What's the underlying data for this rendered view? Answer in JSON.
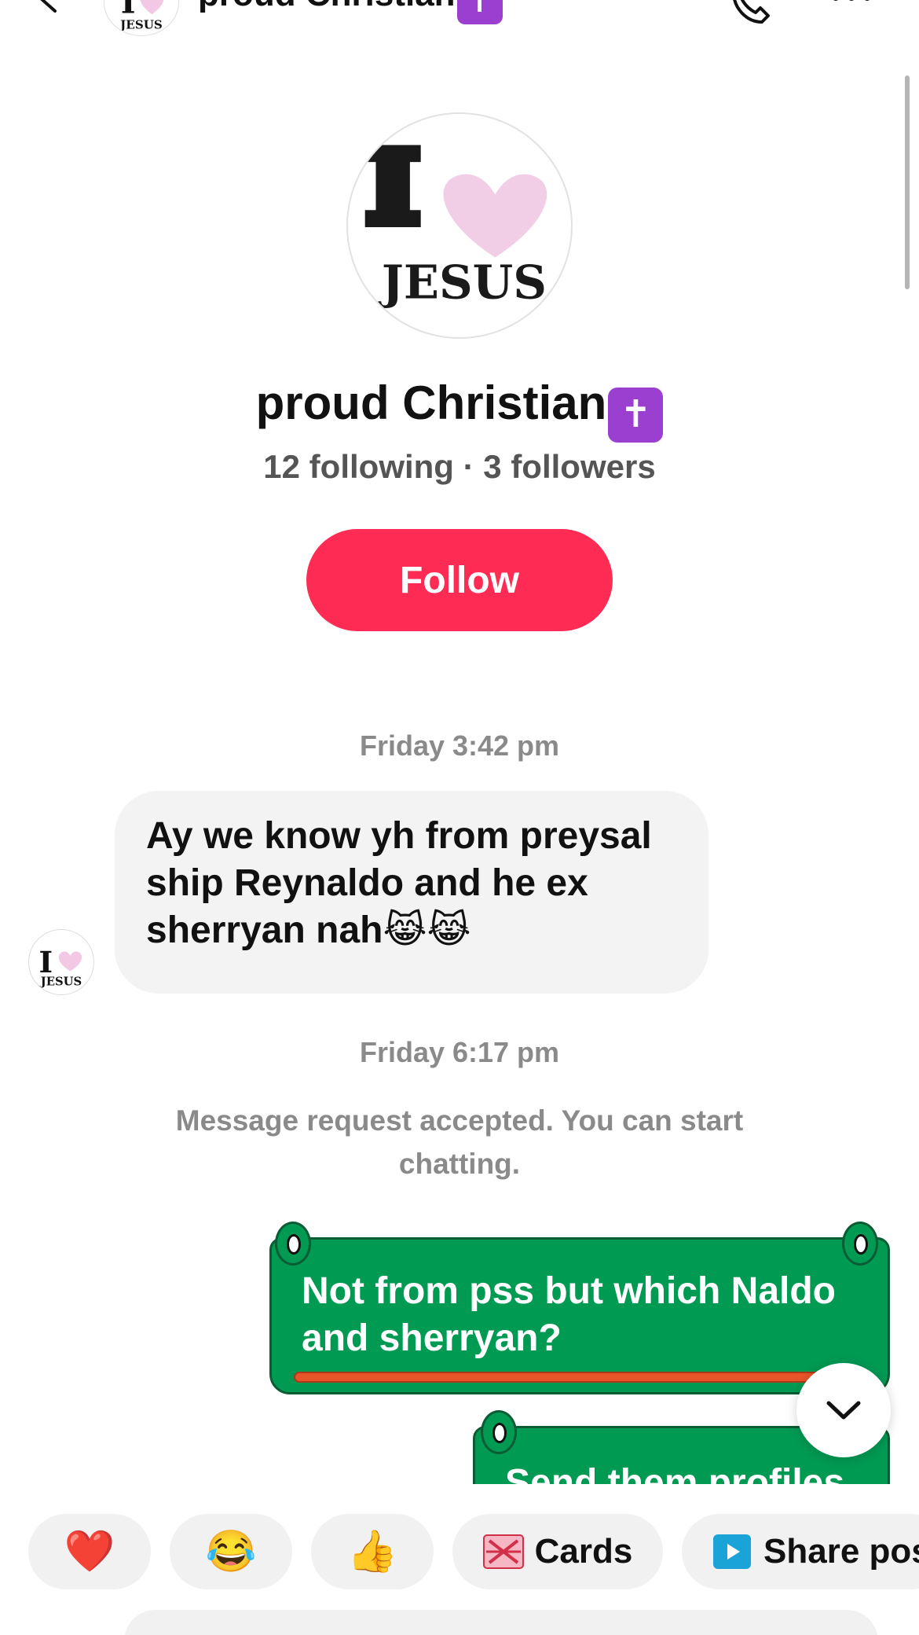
{
  "header": {
    "title": "proud Christian",
    "title_badge": "✝"
  },
  "profile": {
    "avatar_text": "I ♥ JESUS",
    "name": "proud Christian",
    "name_badge": "✝",
    "stats": "12 following · 3 followers",
    "follow_label": "Follow"
  },
  "messages": [
    {
      "timestamp": "Friday 3:42 pm",
      "text": "Ay we know yh from preysal ship Reynaldo and he ex sherryan nah😹😹"
    },
    {
      "timestamp": "Friday 6:17 pm",
      "system": "Message request accepted. You can start chatting."
    }
  ],
  "sent": [
    {
      "text": "Not from pss but which Naldo and sherryan?"
    },
    {
      "text": "Send them profiles"
    }
  ],
  "quick_replies": {
    "heart": "❤️",
    "laugh": "😂",
    "thumb": "👍",
    "cards": "Cards",
    "share": "Share pos"
  },
  "colors": {
    "follow": "#fe2c55",
    "sent_bubble": "#009a53",
    "badge": "#9b3fd0",
    "received_bubble": "#f3f3f3"
  }
}
